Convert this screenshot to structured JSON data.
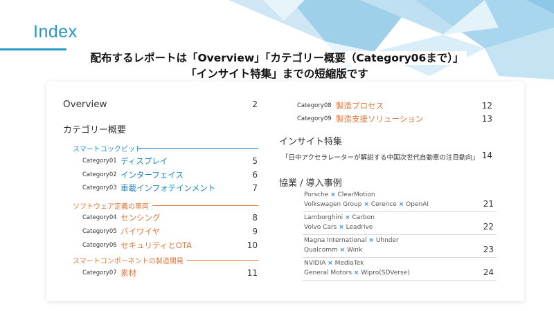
{
  "header": {
    "title": "Index",
    "notice_line1": "配布するレポートは「Overview」「カテゴリー概要（Category06まで）」",
    "notice_line2": "「インサイト特集」までの短縮版です"
  },
  "overview": {
    "label": "Overview",
    "page": "2"
  },
  "category_overview": {
    "heading": "カテゴリー概要",
    "sections": [
      {
        "title": "スマートコックピット",
        "items": [
          {
            "code": "Category01",
            "name": "ディスプレイ",
            "page": "5"
          },
          {
            "code": "Category02",
            "name": "インターフェイス",
            "page": "6"
          },
          {
            "code": "Category03",
            "name": "車載インフォテインメント",
            "page": "7"
          }
        ]
      },
      {
        "title": "ソフトウェア定義の車両",
        "items": [
          {
            "code": "Category04",
            "name": "センシング",
            "page": "8"
          },
          {
            "code": "Category05",
            "name": "バイワイヤ",
            "page": "9"
          },
          {
            "code": "Category06",
            "name": "セキュリティとOTA",
            "page": "10"
          }
        ]
      },
      {
        "title": "スマートコンポーネントの製造開発",
        "items": [
          {
            "code": "Category07",
            "name": "素材",
            "page": "11"
          },
          {
            "code": "Category08",
            "name": "製造プロセス",
            "page": "12"
          },
          {
            "code": "Category09",
            "name": "製造支援ソリューション",
            "page": "13"
          }
        ]
      }
    ]
  },
  "insight": {
    "heading": "インサイト特集",
    "item": "「日中アクセラレーターが解説する中国次世代自動車の注目動向」",
    "page": "14"
  },
  "cases": {
    "heading": "協業 / 導入事例",
    "separator": "×",
    "entries": [
      {
        "line1": [
          "Porsche",
          "ClearMotion"
        ],
        "line2": [
          "Volkswagen Group",
          "Cerence",
          "OpenAI"
        ],
        "page": "21"
      },
      {
        "line1": [
          "Lamborghini",
          "Carbon"
        ],
        "line2": [
          "Volvo Cars",
          "Leadrive"
        ],
        "page": "22"
      },
      {
        "line1": [
          "Magna International",
          "Uhnder"
        ],
        "line2": [
          "Qualcomm",
          "Wink"
        ],
        "page": "23"
      },
      {
        "line1": [
          "NVIDIA",
          "MediaTek"
        ],
        "line2": [
          "General Motors",
          "Wipro(SDVerse)"
        ],
        "page": "24"
      }
    ]
  },
  "colors": {
    "accent_blue": "#2a8ecf",
    "accent_orange": "#e0783c",
    "title_blue": "#2596c8"
  }
}
